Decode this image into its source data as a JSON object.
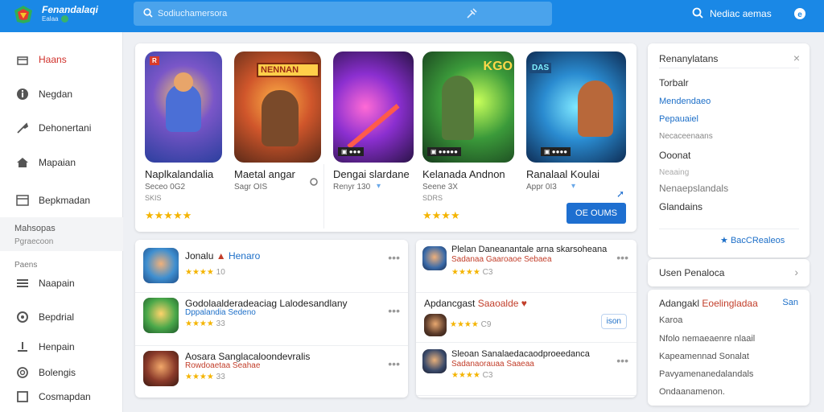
{
  "header": {
    "brand_name": "Fenandalaqi",
    "brand_sub": "Ealaa",
    "search_placeholder": "Sodiuchamersora",
    "right_label": "Nediac aemas"
  },
  "sidebar": {
    "items": [
      {
        "label": "Haans",
        "icon": "gift-icon",
        "active": true
      },
      {
        "label": "Negdan",
        "icon": "info-icon",
        "active": false
      },
      {
        "label": "Dehonertani",
        "icon": "wrench-icon",
        "active": false
      },
      {
        "label": "Mapaian",
        "icon": "home-icon",
        "active": false
      },
      {
        "label": "Bepkmadan",
        "icon": "grid-icon",
        "active": false
      }
    ],
    "section_title": "Mahsopas",
    "section_sub": "Pgraecoon",
    "sub_label": "Paens",
    "sub_items": [
      {
        "label": "Naapain",
        "icon": "list-icon"
      },
      {
        "label": "Bepdrial",
        "icon": "globe-icon"
      },
      {
        "label": "Henpain",
        "icon": "person-icon"
      },
      {
        "label": "Bolengis",
        "icon": "refresh-icon"
      },
      {
        "label": "Cosmapdan",
        "icon": "window-icon"
      }
    ]
  },
  "featured": {
    "cards": [
      {
        "title": "Naplkalandalia",
        "sub": "Seceo 0G2",
        "sub2": "SKIS",
        "stars": "★★★★★",
        "badge": "R"
      },
      {
        "title": "Maetal angar",
        "sub": "Sagr OIS",
        "sub2": "",
        "stars": "",
        "badge": "NENNAN"
      },
      {
        "title": "Dengai slardane",
        "sub": "Renyr 130",
        "sub2": "",
        "stars": "",
        "badge": ""
      },
      {
        "title": "Kelanada Andnon",
        "sub": "Seene 3X",
        "sub2": "SDRS",
        "stars": "★★★★",
        "badge": "KGO"
      },
      {
        "title": "Ranalaal Koulai",
        "sub": "Appr 0I3",
        "sub2": "",
        "stars": "",
        "badge": "DAS"
      }
    ],
    "action_label": "OE OUMS"
  },
  "list_left": [
    {
      "title": "Jonalu",
      "title2": "Henaro",
      "meta": "",
      "rating_stars": "★★★★",
      "rating_text": "10"
    },
    {
      "title": "Godolaalderadeaciag Lalodesandlany",
      "title2": "",
      "meta": "Dppalandia Sedeno",
      "rating_stars": "★★★★",
      "rating_text": "33"
    },
    {
      "title": "Aosara Sanglacaloondevralis",
      "title2": "",
      "meta": "Rowdoaetaa Seahae",
      "rating_stars": "★★★★",
      "rating_text": "33"
    }
  ],
  "list_right": [
    {
      "title": "Plelan Daneanantale arna skarsoheana",
      "meta": "Sadanaa Gaaroaoe Sebaea",
      "rating_stars": "★★★★",
      "rating_text": "C3"
    },
    {
      "title": "Apdancgast",
      "title2": "Saaoalde",
      "meta": "",
      "rating_stars": "★★★★",
      "rating_text": "C9",
      "button": "ison"
    },
    {
      "title": "Sleoan Sanalaedacaodproeedanca",
      "meta": "Sadanaorauaa Saaeaa",
      "rating_stars": "★★★★",
      "rating_text": "C3"
    }
  ],
  "right_panel_top": {
    "title": "Renanylatans",
    "items": [
      {
        "text": "Torbalr",
        "color": "#333"
      },
      {
        "text": "Mendendaeo",
        "color": "#1d6fc8"
      },
      {
        "text": "Pepauaiel",
        "color": "#1d6fc8"
      },
      {
        "text": "Necaceenaans",
        "color": "#888"
      },
      {
        "text": "Ooonat",
        "color": "#333"
      },
      {
        "text": "Neaaing",
        "color": "#aaa"
      },
      {
        "text": "Nenaepslandals",
        "color": "#777"
      },
      {
        "text": "Glandains",
        "color": "#333"
      }
    ],
    "footer_link": "BacCRealeos"
  },
  "right_panel_mid": {
    "title": "Usen Penaloca"
  },
  "right_panel_bottom": {
    "title": "Adangakl",
    "title2": "Eoelingladaa",
    "action": "San",
    "items": [
      "Karoa",
      "Nfolo nemaeaenre nlaail",
      "Kapeamennad Sonalat",
      "Pavyamenanedalandals",
      "Ondaanamenon."
    ]
  },
  "colors": {
    "topbar": "#1a88e6",
    "accent": "#1e6fd0",
    "active_nav": "#d0302a",
    "star": "#f4b400"
  }
}
